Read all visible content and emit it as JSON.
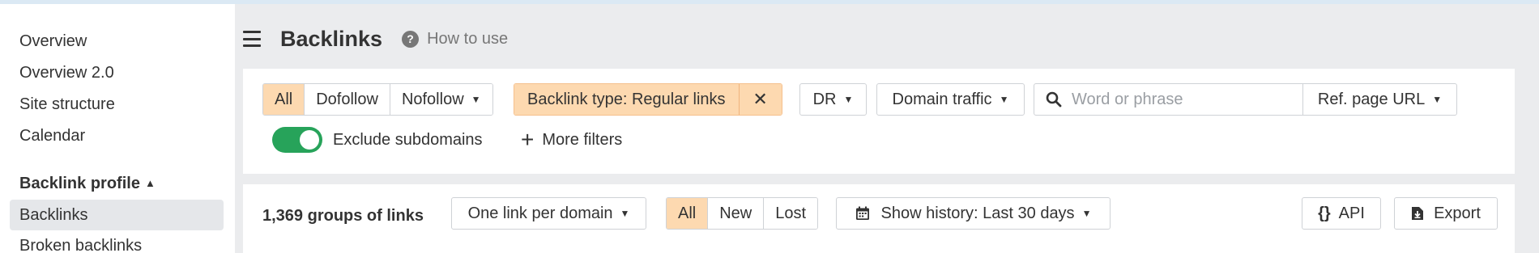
{
  "sidebar": {
    "items": [
      {
        "label": "Overview"
      },
      {
        "label": "Overview 2.0"
      },
      {
        "label": "Site structure"
      },
      {
        "label": "Calendar"
      }
    ],
    "section_heading": "Backlink profile",
    "section_items": [
      {
        "label": "Backlinks",
        "active": true
      },
      {
        "label": "Broken backlinks"
      }
    ]
  },
  "header": {
    "title": "Backlinks",
    "help_label": "How to use"
  },
  "filters": {
    "link_type_segments": [
      "All",
      "Dofollow",
      "Nofollow"
    ],
    "active_segment": "All",
    "backlink_type_label": "Backlink type: Regular links",
    "dr_label": "DR",
    "domain_traffic_label": "Domain traffic",
    "search_placeholder": "Word or phrase",
    "search_value": "",
    "search_target_label": "Ref. page URL",
    "exclude_subdomains_label": "Exclude subdomains",
    "exclude_subdomains_on": true,
    "more_filters_label": "More filters"
  },
  "results": {
    "count_label": "1,369 groups of links",
    "grouping_label": "One link per domain",
    "status_segments": [
      "All",
      "New",
      "Lost"
    ],
    "active_status": "All",
    "history_label": "Show history: Last 30 days",
    "api_label": "API",
    "export_label": "Export"
  },
  "colors": {
    "accent_orange": "#fdd9b0",
    "toggle_green": "#27a35a"
  }
}
